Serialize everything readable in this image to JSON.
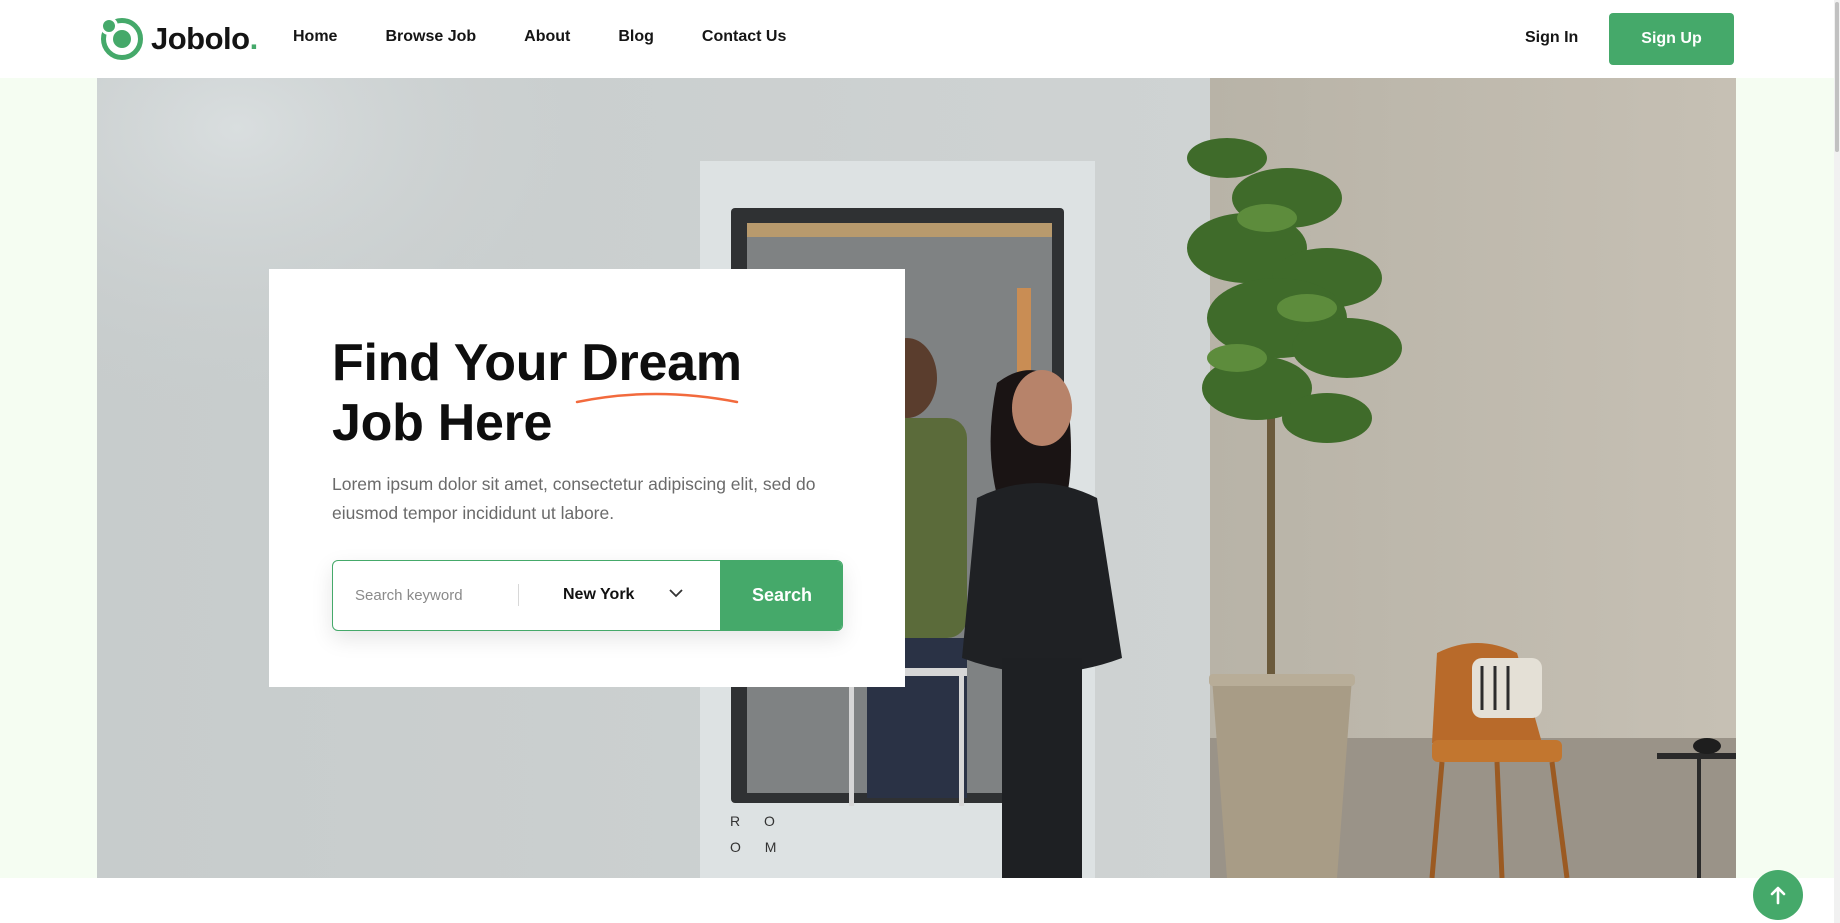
{
  "brand": {
    "name": "Jobolo",
    "dot": "."
  },
  "nav": {
    "items": [
      {
        "label": "Home"
      },
      {
        "label": "Browse Job"
      },
      {
        "label": "About"
      },
      {
        "label": "Blog"
      },
      {
        "label": "Contact Us"
      }
    ]
  },
  "auth": {
    "sign_in": "Sign In",
    "sign_up": "Sign Up"
  },
  "hero": {
    "headline_part1": "Find Your",
    "headline_highlight": "Dream",
    "headline_part2": "Job Here",
    "description": "Lorem ipsum dolor sit amet, consectetur adipiscing elit, sed do eiusmod tempor incididunt ut labore.",
    "image_text": "R O O M"
  },
  "search": {
    "placeholder": "Search keyword",
    "location": "New York",
    "button": "Search"
  },
  "icons": {
    "logo": "logo-ring-icon",
    "chevron": "chevron-down-icon",
    "scroll_top": "arrow-up-icon"
  },
  "colors": {
    "accent": "#45a96a",
    "underline": "#f26a3d",
    "hero_bg": "#f5fdf2"
  }
}
